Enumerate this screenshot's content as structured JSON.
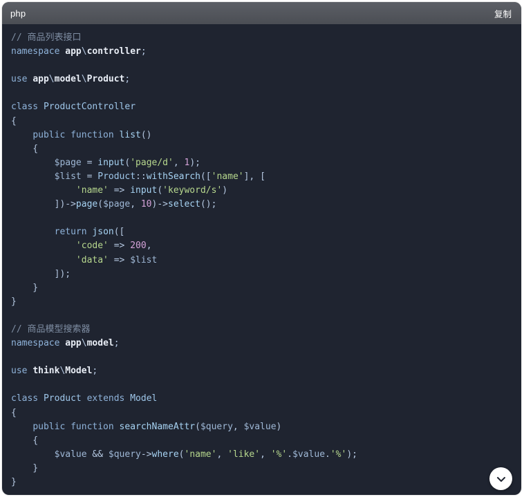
{
  "header": {
    "language": "php",
    "copy_label": "复制"
  },
  "code": {
    "lines": [
      [
        {
          "t": "comment",
          "v": "// 商品列表接口"
        }
      ],
      [
        {
          "t": "keyword",
          "v": "namespace "
        },
        {
          "t": "ident",
          "v": "app"
        },
        {
          "t": "plain",
          "v": "\\"
        },
        {
          "t": "ident",
          "v": "controller"
        },
        {
          "t": "plain",
          "v": ";"
        }
      ],
      [],
      [
        {
          "t": "keyword",
          "v": "use "
        },
        {
          "t": "ident",
          "v": "app"
        },
        {
          "t": "plain",
          "v": "\\"
        },
        {
          "t": "ident",
          "v": "model"
        },
        {
          "t": "plain",
          "v": "\\"
        },
        {
          "t": "ident",
          "v": "Product"
        },
        {
          "t": "plain",
          "v": ";"
        }
      ],
      [],
      [
        {
          "t": "keyword",
          "v": "class "
        },
        {
          "t": "class",
          "v": "ProductController"
        }
      ],
      [
        {
          "t": "plain",
          "v": "{"
        }
      ],
      [
        {
          "t": "plain",
          "v": "    "
        },
        {
          "t": "keyword",
          "v": "public function "
        },
        {
          "t": "func",
          "v": "list"
        },
        {
          "t": "plain",
          "v": "()"
        }
      ],
      [
        {
          "t": "plain",
          "v": "    {"
        }
      ],
      [
        {
          "t": "plain",
          "v": "        "
        },
        {
          "t": "var",
          "v": "$page"
        },
        {
          "t": "plain",
          "v": " = "
        },
        {
          "t": "func",
          "v": "input"
        },
        {
          "t": "plain",
          "v": "("
        },
        {
          "t": "string",
          "v": "'page/d'"
        },
        {
          "t": "plain",
          "v": ", "
        },
        {
          "t": "number",
          "v": "1"
        },
        {
          "t": "plain",
          "v": ");"
        }
      ],
      [
        {
          "t": "plain",
          "v": "        "
        },
        {
          "t": "var",
          "v": "$list"
        },
        {
          "t": "plain",
          "v": " = "
        },
        {
          "t": "class",
          "v": "Product"
        },
        {
          "t": "plain",
          "v": "::"
        },
        {
          "t": "func",
          "v": "withSearch"
        },
        {
          "t": "plain",
          "v": "(["
        },
        {
          "t": "string",
          "v": "'name'"
        },
        {
          "t": "plain",
          "v": "], ["
        }
      ],
      [
        {
          "t": "plain",
          "v": "            "
        },
        {
          "t": "string",
          "v": "'name'"
        },
        {
          "t": "plain",
          "v": " => "
        },
        {
          "t": "func",
          "v": "input"
        },
        {
          "t": "plain",
          "v": "("
        },
        {
          "t": "string",
          "v": "'keyword/s'"
        },
        {
          "t": "plain",
          "v": ")"
        }
      ],
      [
        {
          "t": "plain",
          "v": "        ])->"
        },
        {
          "t": "func",
          "v": "page"
        },
        {
          "t": "plain",
          "v": "("
        },
        {
          "t": "var",
          "v": "$page"
        },
        {
          "t": "plain",
          "v": ", "
        },
        {
          "t": "number",
          "v": "10"
        },
        {
          "t": "plain",
          "v": ")->"
        },
        {
          "t": "func",
          "v": "select"
        },
        {
          "t": "plain",
          "v": "();"
        }
      ],
      [],
      [
        {
          "t": "plain",
          "v": "        "
        },
        {
          "t": "keyword",
          "v": "return "
        },
        {
          "t": "func",
          "v": "json"
        },
        {
          "t": "plain",
          "v": "(["
        }
      ],
      [
        {
          "t": "plain",
          "v": "            "
        },
        {
          "t": "string",
          "v": "'code'"
        },
        {
          "t": "plain",
          "v": " => "
        },
        {
          "t": "number",
          "v": "200"
        },
        {
          "t": "plain",
          "v": ","
        }
      ],
      [
        {
          "t": "plain",
          "v": "            "
        },
        {
          "t": "string",
          "v": "'data'"
        },
        {
          "t": "plain",
          "v": " => "
        },
        {
          "t": "var",
          "v": "$list"
        }
      ],
      [
        {
          "t": "plain",
          "v": "        ]);"
        }
      ],
      [
        {
          "t": "plain",
          "v": "    }"
        }
      ],
      [
        {
          "t": "plain",
          "v": "}"
        }
      ],
      [],
      [
        {
          "t": "comment",
          "v": "// 商品模型搜索器"
        }
      ],
      [
        {
          "t": "keyword",
          "v": "namespace "
        },
        {
          "t": "ident",
          "v": "app"
        },
        {
          "t": "plain",
          "v": "\\"
        },
        {
          "t": "ident",
          "v": "model"
        },
        {
          "t": "plain",
          "v": ";"
        }
      ],
      [],
      [
        {
          "t": "keyword",
          "v": "use "
        },
        {
          "t": "ident",
          "v": "think"
        },
        {
          "t": "plain",
          "v": "\\"
        },
        {
          "t": "ident",
          "v": "Model"
        },
        {
          "t": "plain",
          "v": ";"
        }
      ],
      [],
      [
        {
          "t": "keyword",
          "v": "class "
        },
        {
          "t": "class",
          "v": "Product"
        },
        {
          "t": "keyword",
          "v": " extends "
        },
        {
          "t": "class",
          "v": "Model"
        }
      ],
      [
        {
          "t": "plain",
          "v": "{"
        }
      ],
      [
        {
          "t": "plain",
          "v": "    "
        },
        {
          "t": "keyword",
          "v": "public function "
        },
        {
          "t": "func",
          "v": "searchNameAttr"
        },
        {
          "t": "plain",
          "v": "("
        },
        {
          "t": "var",
          "v": "$query"
        },
        {
          "t": "plain",
          "v": ", "
        },
        {
          "t": "var",
          "v": "$value"
        },
        {
          "t": "plain",
          "v": ")"
        }
      ],
      [
        {
          "t": "plain",
          "v": "    {"
        }
      ],
      [
        {
          "t": "plain",
          "v": "        "
        },
        {
          "t": "var",
          "v": "$value"
        },
        {
          "t": "plain",
          "v": " && "
        },
        {
          "t": "var",
          "v": "$query"
        },
        {
          "t": "plain",
          "v": "->"
        },
        {
          "t": "func",
          "v": "where"
        },
        {
          "t": "plain",
          "v": "("
        },
        {
          "t": "string",
          "v": "'name'"
        },
        {
          "t": "plain",
          "v": ", "
        },
        {
          "t": "string",
          "v": "'like'"
        },
        {
          "t": "plain",
          "v": ", "
        },
        {
          "t": "string",
          "v": "'%'"
        },
        {
          "t": "plain",
          "v": "."
        },
        {
          "t": "var",
          "v": "$value"
        },
        {
          "t": "plain",
          "v": "."
        },
        {
          "t": "string",
          "v": "'%'"
        },
        {
          "t": "plain",
          "v": ");"
        }
      ],
      [
        {
          "t": "plain",
          "v": "    }"
        }
      ],
      [
        {
          "t": "plain",
          "v": "}"
        }
      ]
    ]
  },
  "scroll_button": {
    "icon": "chevron-down-icon"
  },
  "colors": {
    "code_background": "#1f2430",
    "header_background": "#55585e",
    "comment": "#7f8ea3",
    "keyword": "#8fb3da",
    "string": "#b7d88e",
    "number": "#d4a3d9"
  }
}
